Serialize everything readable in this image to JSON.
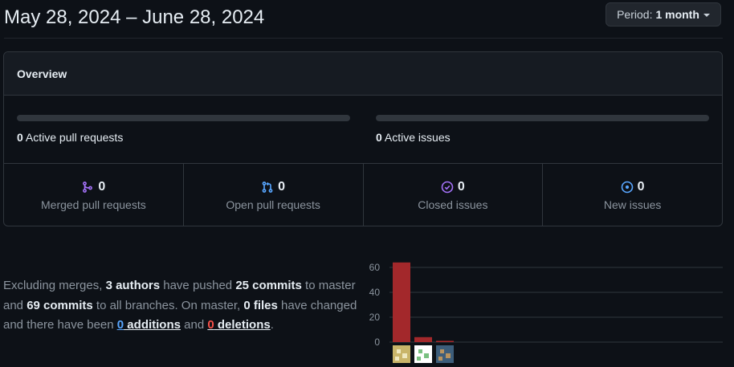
{
  "header": {
    "date_range": "May 28, 2024 – June 28, 2024",
    "period_label": "Period:",
    "period_value": "1 month"
  },
  "overview": {
    "title": "Overview",
    "active_prs_count": "0",
    "active_prs_label": "Active pull requests",
    "active_issues_count": "0",
    "active_issues_label": "Active issues",
    "stats": [
      {
        "icon": "merged-pr-icon",
        "count": "0",
        "label": "Merged pull requests",
        "color": "#a371f7"
      },
      {
        "icon": "open-pr-icon",
        "count": "0",
        "label": "Open pull requests",
        "color": "#58a6ff"
      },
      {
        "icon": "closed-issue-icon",
        "count": "0",
        "label": "Closed issues",
        "color": "#a371f7"
      },
      {
        "icon": "new-issue-icon",
        "count": "0",
        "label": "New issues",
        "color": "#58a6ff"
      }
    ]
  },
  "summary": {
    "t1": "Excluding merges, ",
    "authors": "3 authors",
    "t2": " have pushed ",
    "commits": "25 commits",
    "t3": " to master and ",
    "all_commits": "69 commits",
    "t4": " to all branches. On master, ",
    "files": "0 files",
    "t5": " have changed and there have been ",
    "additions_count": "0",
    "additions_word": " additions",
    "t6": " and ",
    "deletions_count": "0",
    "deletions_word": " deletions",
    "t7": "."
  },
  "chart_data": {
    "type": "bar",
    "categories": [
      "author-1",
      "author-2",
      "author-3"
    ],
    "values": [
      64,
      4,
      1
    ],
    "ylim": [
      0,
      60
    ],
    "yticks": [
      0,
      20,
      40,
      60
    ],
    "bar_color": "#a3282b",
    "grid": true
  }
}
